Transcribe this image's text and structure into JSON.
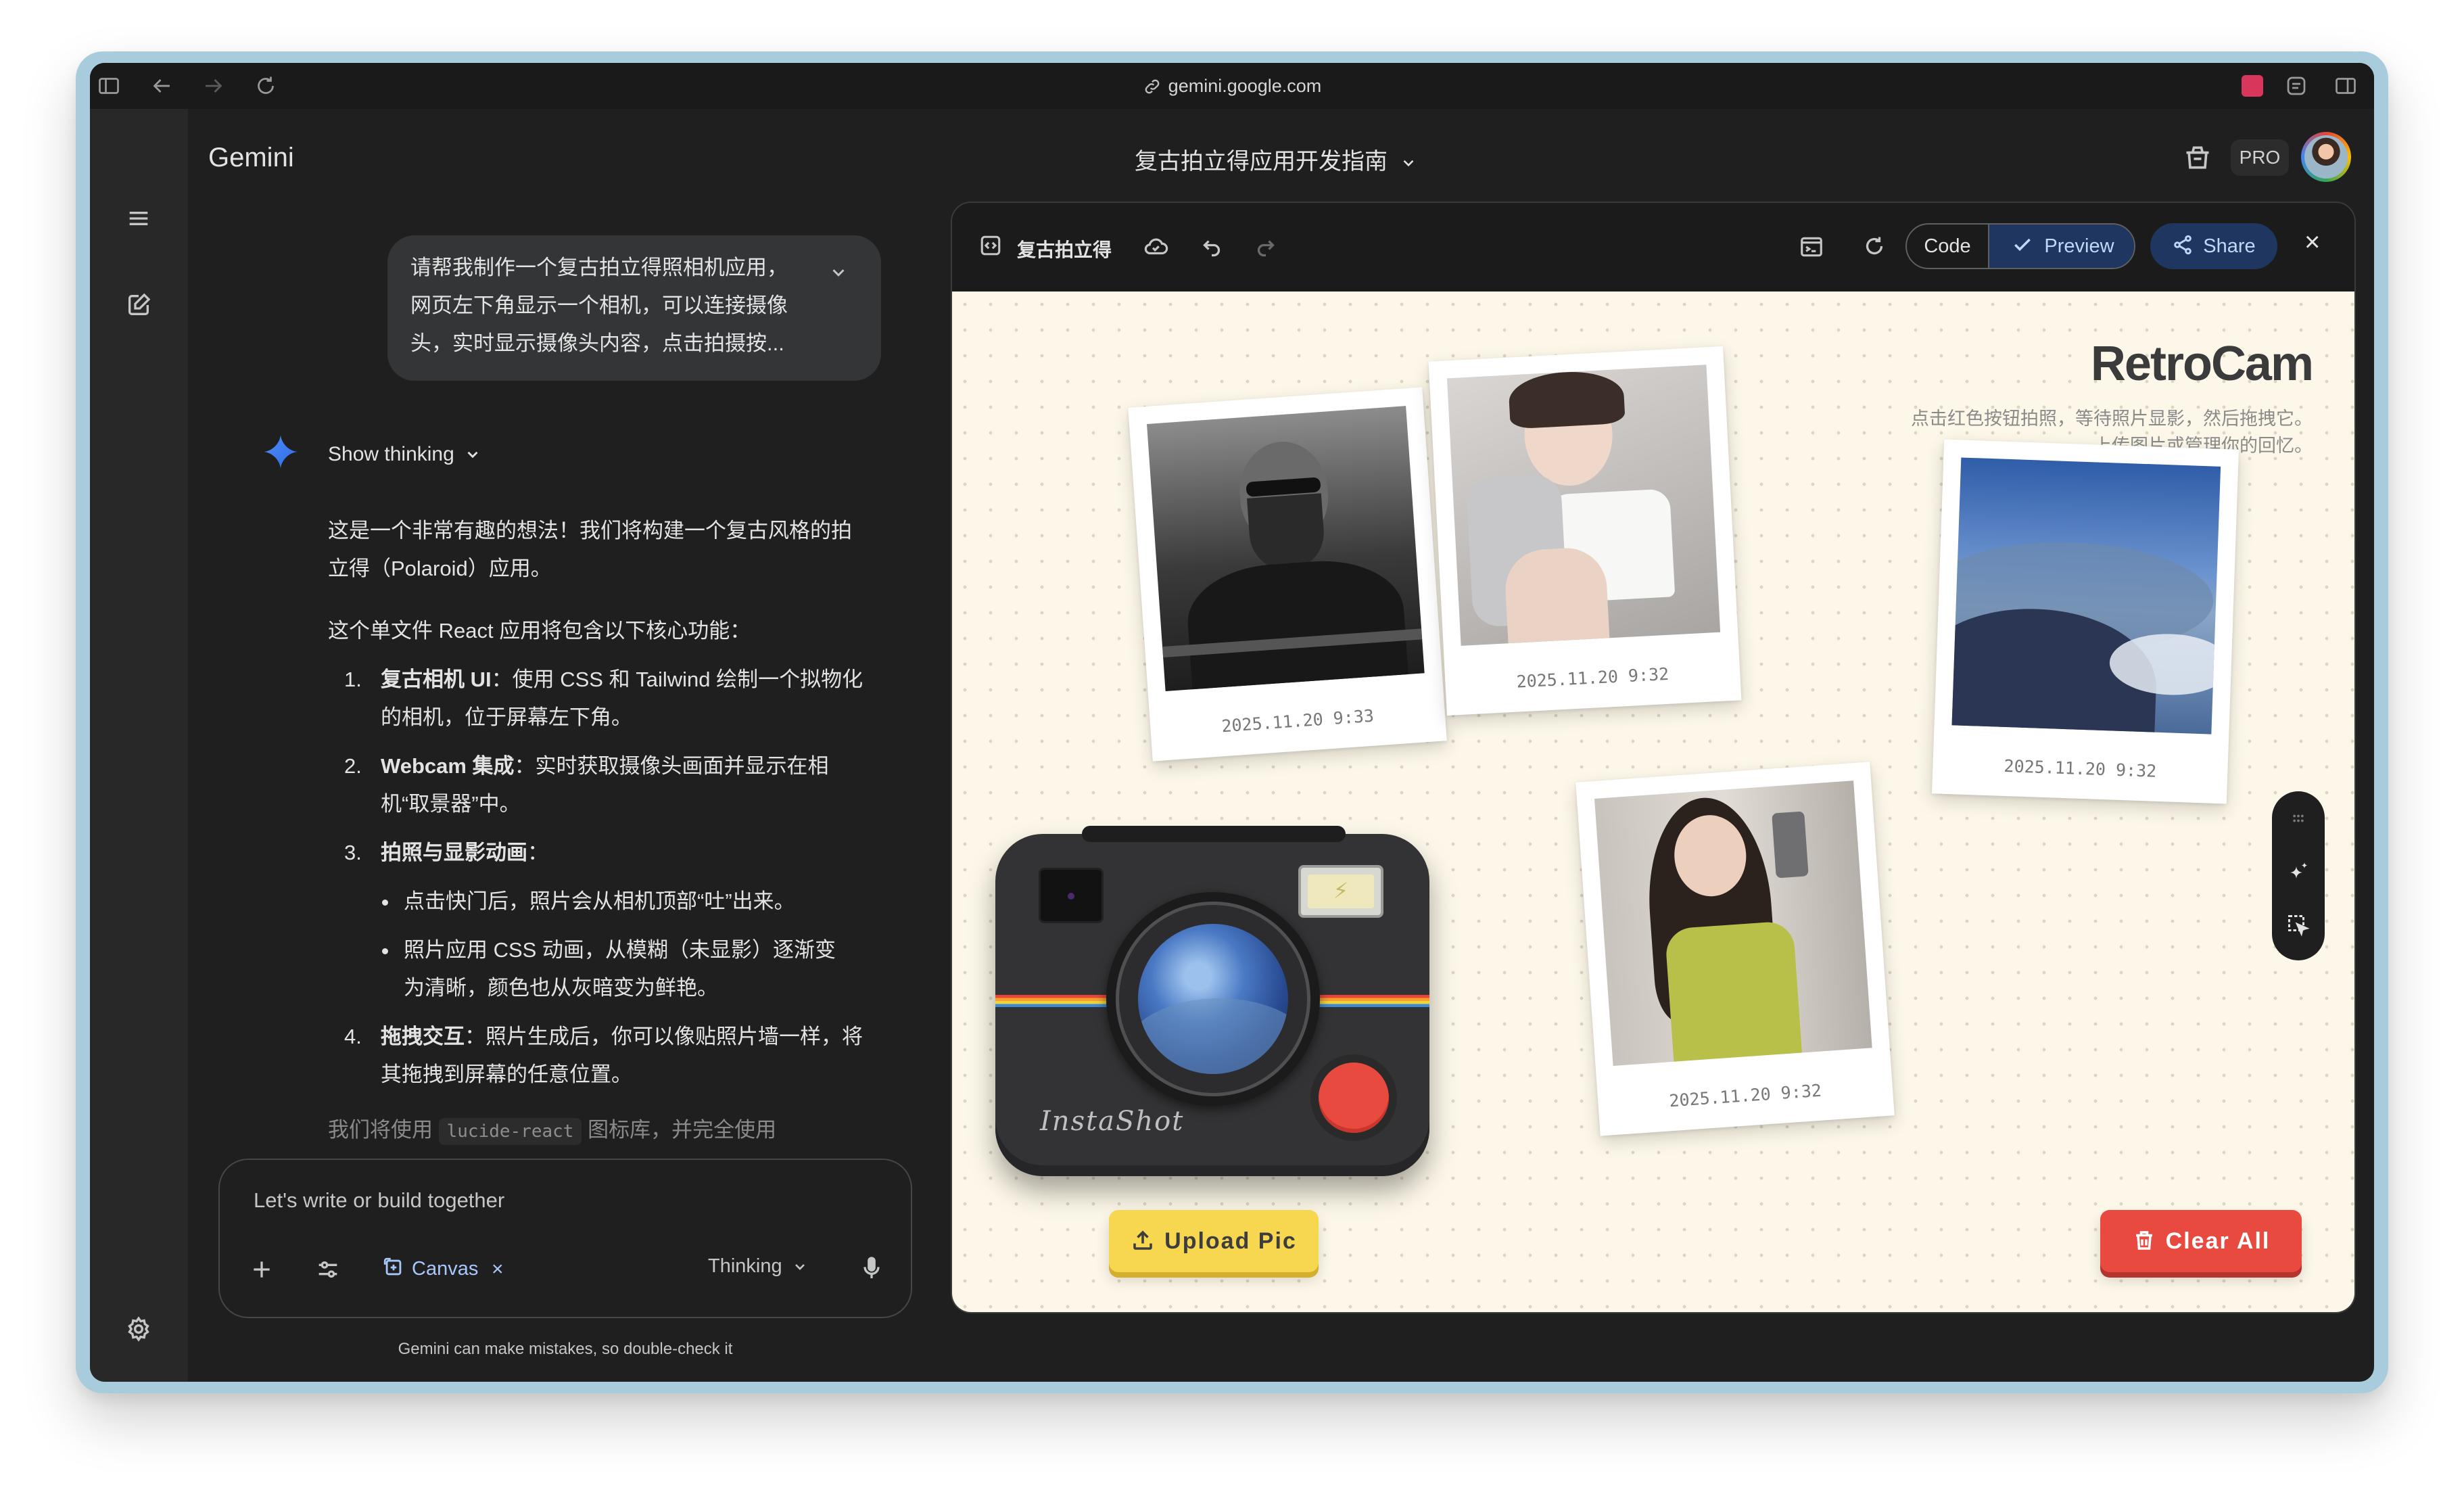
{
  "browser": {
    "url": "gemini.google.com"
  },
  "app": {
    "name": "Gemini",
    "doc_title": "复古拍立得应用开发指南",
    "pro_label": "PRO"
  },
  "chat": {
    "user_message_lines": [
      "请帮我制作一个复古拍立得照相机应用，",
      "网页左下角显示一个相机，可以连接摄像",
      "头，实时显示摄像头内容，点击拍摄按..."
    ],
    "show_thinking": "Show thinking",
    "intro_lines": [
      "这是一个非常有趣的想法！我们将构建一个复古风格的拍",
      "立得（Polaroid）应用。"
    ],
    "features_intro": "这个单文件 React 应用将包含以下核心功能：",
    "features": [
      {
        "num": "1.",
        "title": "复古相机 UI",
        "text_lines": [
          "：使用 CSS 和 Tailwind 绘制一个拟物化",
          "的相机，位于屏幕左下角。"
        ]
      },
      {
        "num": "2.",
        "title": "Webcam 集成",
        "text_lines": [
          "：实时获取摄像头画面并显示在相",
          "机“取景器”中。"
        ]
      },
      {
        "num": "3.",
        "title": "拍照与显影动画",
        "text_lines": [
          "："
        ]
      },
      {
        "num": "4.",
        "title": "拖拽交互",
        "text_lines": [
          "：照片生成后，你可以像贴照片墙一样，将",
          "其拖拽到屏幕的任意位置。"
        ]
      }
    ],
    "sub_bullets": [
      {
        "lines": [
          "点击快门后，照片会从相机顶部“吐”出来。"
        ]
      },
      {
        "lines": [
          "照片应用 CSS 动画，从模糊（未显影）逐渐变",
          "为清晰，颜色也从灰暗变为鲜艳。"
        ]
      }
    ],
    "trailing_pre": "我们将使用",
    "trailing_code": "lucide-react",
    "trailing_post": "图标库，并完全使用"
  },
  "input": {
    "placeholder": "Let's write or build together",
    "canvas_label": "Canvas",
    "canvas_close": "×",
    "mode_label": "Thinking",
    "disclaimer": "Gemini can make mistakes, so double-check it"
  },
  "canvas": {
    "title": "复古拍立得",
    "code_label": "Code",
    "preview_label": "Preview",
    "share_label": "Share",
    "close": "×"
  },
  "preview": {
    "app_title": "RetroCam",
    "subtitle_lines": [
      "点击红色按钮拍照，等待照片显影，然后拖拽它。",
      "上传图片或管理你的回忆。"
    ],
    "photos": [
      {
        "date": "2025.11.20 9:33",
        "subject": "man-with-sunglasses-bw"
      },
      {
        "date": "2025.11.20 9:32",
        "subject": "woman-white-top"
      },
      {
        "date": "2025.11.20 9:32",
        "subject": "sky-from-airplane"
      },
      {
        "date": "2025.11.20 9:32",
        "subject": "woman-mirror-selfie"
      }
    ],
    "camera_brand": "InstaShot",
    "upload_label": "Upload Pic",
    "clear_label": "Clear All",
    "colors": {
      "paper": "#fcf7e8",
      "upload": "#f8d750",
      "clear": "#e84a40",
      "camera_body": "#333335"
    }
  }
}
